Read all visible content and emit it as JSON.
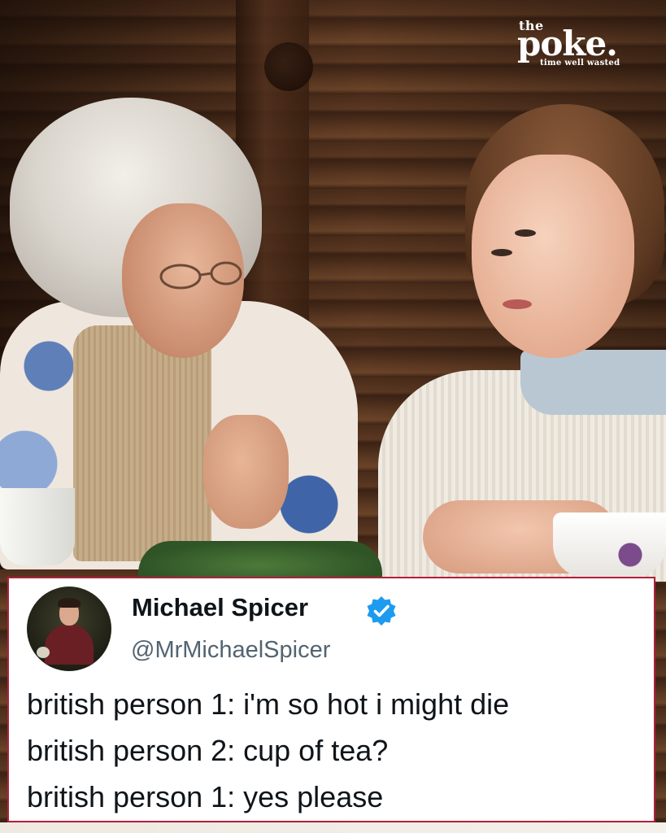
{
  "logo": {
    "top": "the",
    "wordmark": "poke.",
    "tagline": "time well wasted"
  },
  "tweet": {
    "display_name": "Michael Spicer",
    "handle": "@MrMichaelSpicer",
    "verified_icon": "verified-badge-icon",
    "lines": [
      "british person 1: i'm so hot i might die",
      "british person 2: cup of tea?",
      "british person 1: yes please"
    ]
  },
  "colors": {
    "card_border": "#b0203a",
    "name_text": "#0f1419",
    "handle_text": "#536471",
    "verified_blue": "#1d9bf0",
    "logo_text": "#ffffff"
  }
}
